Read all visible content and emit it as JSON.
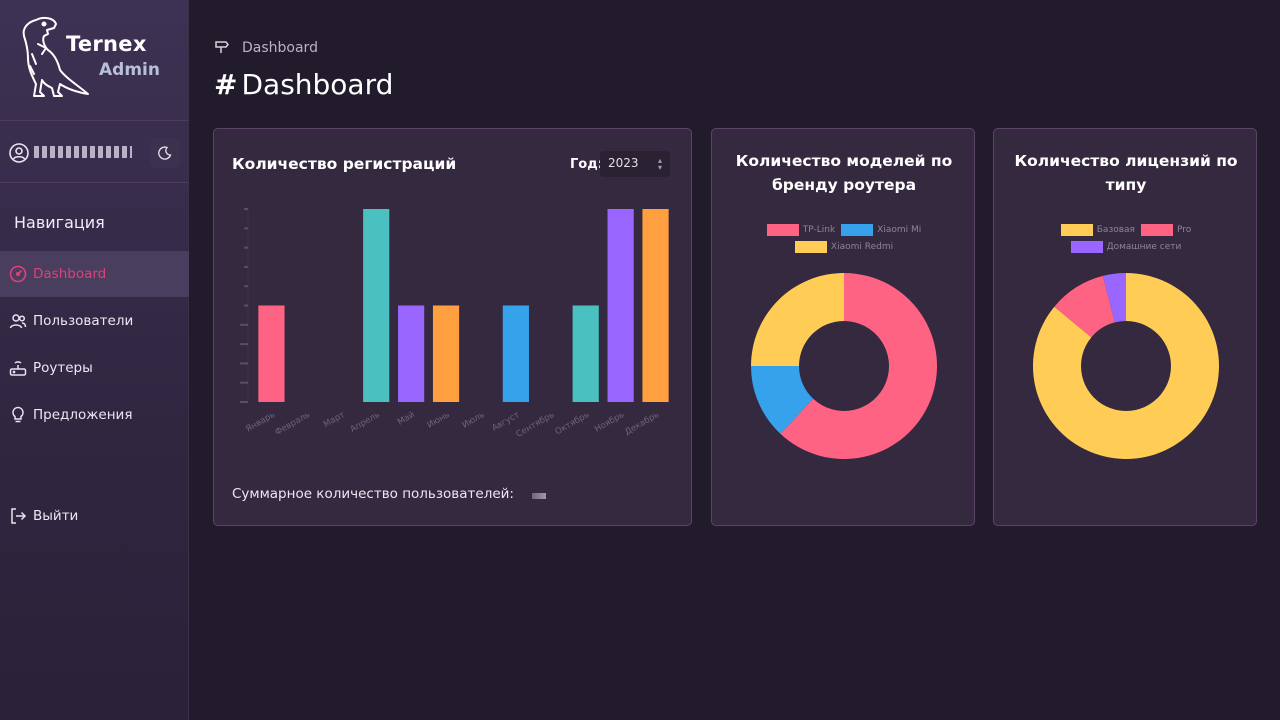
{
  "sidebar": {
    "brand_name": "Ternex",
    "brand_sub": "Admin",
    "nav_title": "Навигация",
    "items": [
      {
        "label": "Dashboard",
        "icon": "dashboard-icon",
        "active": true
      },
      {
        "label": "Пользователи",
        "icon": "users-icon"
      },
      {
        "label": "Роутеры",
        "icon": "router-icon"
      },
      {
        "label": "Предложения",
        "icon": "lightbulb-icon"
      }
    ],
    "logout_label": "Выйти"
  },
  "header": {
    "breadcrumb": "Dashboard",
    "title": "Dashboard",
    "title_hash": "#"
  },
  "colors": {
    "pink": "#ff6384",
    "blue": "#36a2eb",
    "yellow": "#ffcd56",
    "teal": "#4bc0c0",
    "purple": "#9966ff",
    "orange": "#ff9f40",
    "active_nav": "#e0407a"
  },
  "registrations_card": {
    "title": "Количество регистраций",
    "year_label": "Год:",
    "year_value": "2023",
    "footer_label": "Суммарное количество пользователей:"
  },
  "brands_card": {
    "title_line1": "Количество моделей по",
    "title_line2": "бренду роутера"
  },
  "licenses_card": {
    "title_line1": "Количество лицензий по",
    "title_line2": "типу"
  },
  "chart_data": [
    {
      "type": "bar",
      "categories": [
        "Январь",
        "Февраль",
        "Март",
        "Апрель",
        "Май",
        "Июнь",
        "Июль",
        "Август",
        "Сентябрь",
        "Октябрь",
        "Ноябрь",
        "Декабрь"
      ],
      "values": [
        1,
        0,
        0,
        2,
        1,
        1,
        0,
        1,
        0,
        1,
        2,
        2
      ],
      "bar_colors": [
        "#ff6384",
        "#36a2eb",
        "#ffcd56",
        "#4bc0c0",
        "#9966ff",
        "#ff9f40",
        "#ff6384",
        "#36a2eb",
        "#ffcd56",
        "#4bc0c0",
        "#9966ff",
        "#ff9f40"
      ],
      "ylim": [
        0,
        2
      ],
      "grid": false
    },
    {
      "type": "pie",
      "labels": [
        "TP-Link",
        "Xiaomi Mi",
        "Xiaomi Redmi"
      ],
      "values": [
        62,
        13,
        25
      ],
      "colors": [
        "#ff6384",
        "#36a2eb",
        "#ffcd56"
      ],
      "legend": "top"
    },
    {
      "type": "pie",
      "labels": [
        "Базовая",
        "Pro",
        "Домашние сети"
      ],
      "values": [
        86,
        10,
        4
      ],
      "colors": [
        "#ffcd56",
        "#ff6384",
        "#9966ff"
      ],
      "legend": "top"
    }
  ]
}
